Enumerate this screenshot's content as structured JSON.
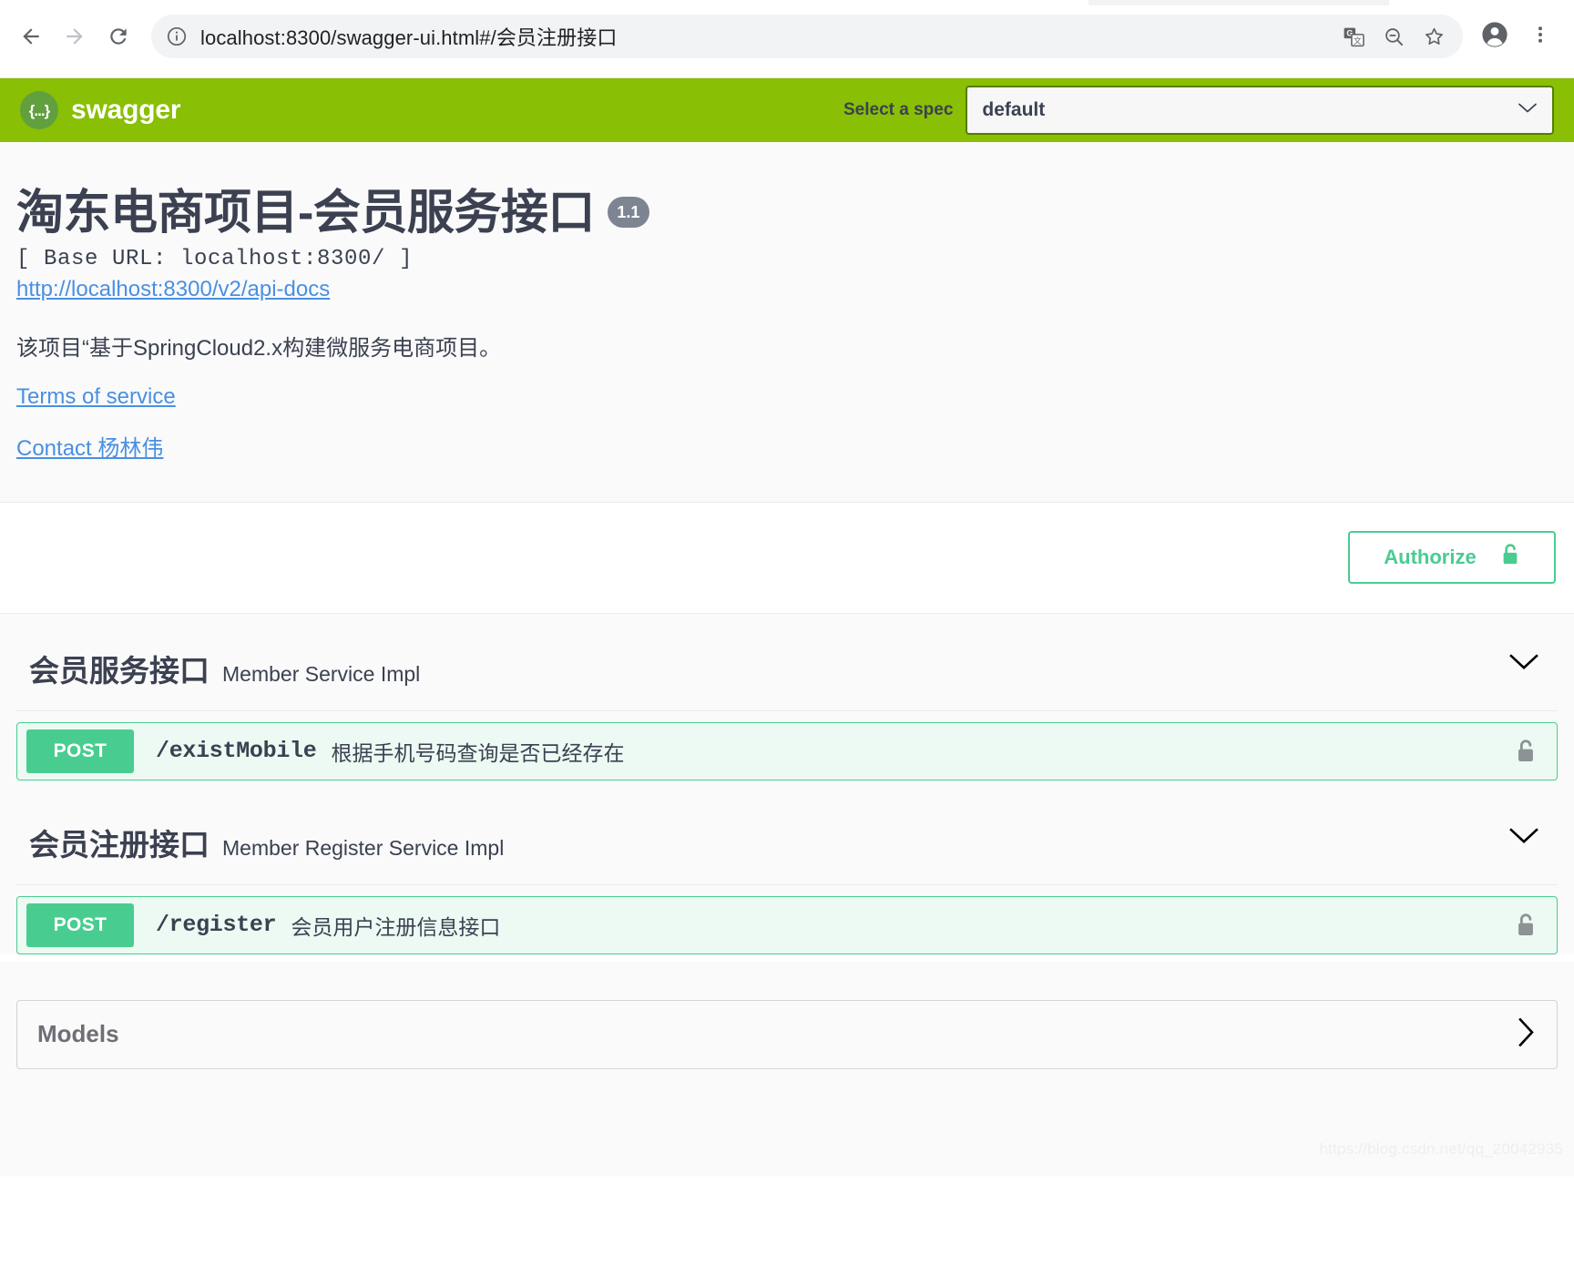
{
  "browser": {
    "back_icon": "back-arrow-icon",
    "forward_icon": "forward-arrow-icon",
    "reload_icon": "reload-icon",
    "site_info_icon": "site-info-icon",
    "url": "localhost:8300/swagger-ui.html#/会员注册接口",
    "url_host": "localhost:8300",
    "url_rest": "/swagger-ui.html#/会员注册接口",
    "translate_icon": "translate-icon",
    "zoom_out_icon": "zoom-out-icon",
    "bookmark_icon": "star-bookmark-icon",
    "profile_icon": "profile-avatar-icon",
    "menu_icon": "three-dot-menu-icon"
  },
  "topbar": {
    "logo_mark": "{...}",
    "logo_text": "swagger",
    "spec_label": "Select a spec",
    "spec_selected": "default",
    "spec_options": [
      "default"
    ],
    "bg_color": "#89bf04"
  },
  "info": {
    "title": "淘东电商项目-会员服务接口",
    "version": "1.1",
    "base_url": "[ Base URL: localhost:8300/ ]",
    "api_docs_link": "http://localhost:8300/v2/api-docs",
    "description": "该项目“基于SpringCloud2.x构建微服务电商项目。",
    "terms_link": "Terms of service",
    "contact_link": "Contact 杨林伟"
  },
  "authorize": {
    "label": "Authorize",
    "lock_icon": "unlock-icon",
    "accent_color": "#49cc90"
  },
  "tags": [
    {
      "name": "会员服务接口",
      "description": "Member Service Impl",
      "expanded": true,
      "chevron": "chevron-down-icon",
      "operations": [
        {
          "method": "POST",
          "path": "/existMobile",
          "summary": "根据手机号码查询是否已经存在",
          "lock_icon": "unlock-icon"
        }
      ]
    },
    {
      "name": "会员注册接口",
      "description": "Member Register Service Impl",
      "expanded": true,
      "chevron": "chevron-down-icon",
      "operations": [
        {
          "method": "POST",
          "path": "/register",
          "summary": "会员用户注册信息接口",
          "lock_icon": "unlock-icon"
        }
      ]
    }
  ],
  "models": {
    "title": "Models",
    "chevron": "chevron-right-icon",
    "expanded": false
  },
  "watermark": "https://blog.csdn.net/qq_20042935"
}
